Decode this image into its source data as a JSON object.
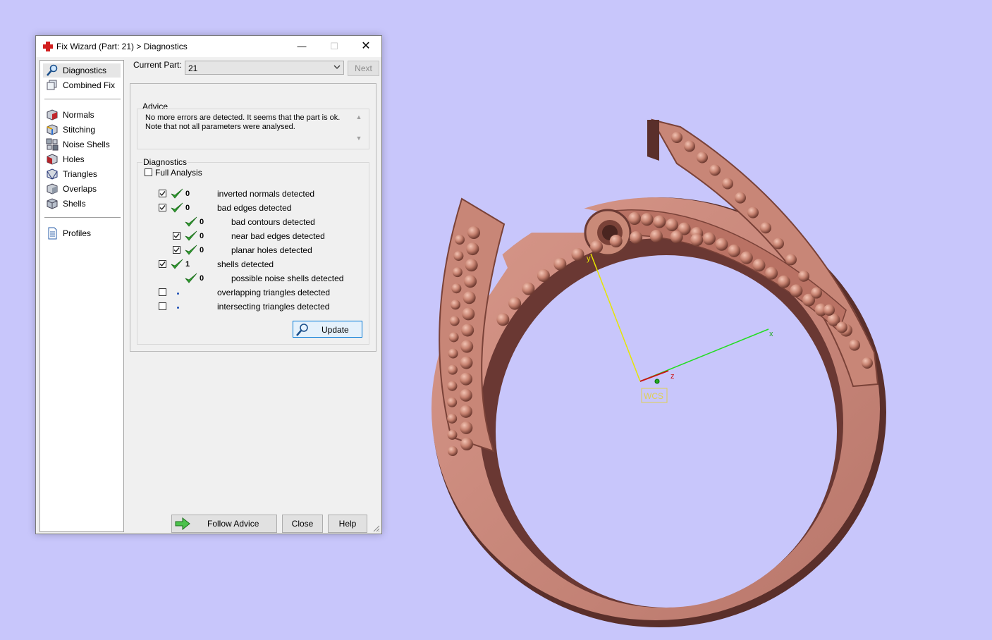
{
  "window": {
    "title": "Fix Wizard (Part: 21) > Diagnostics",
    "controls": {
      "minimize": "—",
      "maximize": "☐",
      "close": "✕"
    }
  },
  "sidebar": {
    "groups": [
      [
        {
          "label": "Diagnostics",
          "icon": "magnifier-icon",
          "selected": true
        },
        {
          "label": "Combined Fix",
          "icon": "cube-stack-icon"
        }
      ],
      [
        {
          "label": "Normals",
          "icon": "normals-cube-icon"
        },
        {
          "label": "Stitching",
          "icon": "stitching-cube-icon"
        },
        {
          "label": "Noise Shells",
          "icon": "noise-shells-icon"
        },
        {
          "label": "Holes",
          "icon": "holes-cube-icon"
        },
        {
          "label": "Triangles",
          "icon": "triangles-cube-icon"
        },
        {
          "label": "Overlaps",
          "icon": "overlaps-cube-icon"
        },
        {
          "label": "Shells",
          "icon": "shells-cube-icon"
        }
      ],
      [
        {
          "label": "Profiles",
          "icon": "document-icon"
        }
      ]
    ]
  },
  "header": {
    "current_part_label": "Current Part:",
    "current_part_value": "21",
    "next_label": "Next"
  },
  "advice": {
    "title": "Advice",
    "text": "No more errors are detected. It seems that the part is ok. Note that not all parameters were analysed."
  },
  "diagnostics": {
    "title": "Diagnostics",
    "full_analysis_label": "Full Analysis",
    "full_analysis_checked": false,
    "rows": [
      {
        "checked": true,
        "has_checkbox": true,
        "status": "ok",
        "count": "0",
        "label": "inverted normals detected",
        "indent": 0
      },
      {
        "checked": true,
        "has_checkbox": true,
        "status": "ok",
        "count": "0",
        "label": "bad edges detected",
        "indent": 0
      },
      {
        "checked": false,
        "has_checkbox": false,
        "status": "ok",
        "count": "0",
        "label": "bad contours detected",
        "indent": 1
      },
      {
        "checked": true,
        "has_checkbox": true,
        "status": "ok",
        "count": "0",
        "label": "near bad edges detected",
        "indent": 1
      },
      {
        "checked": true,
        "has_checkbox": true,
        "status": "ok",
        "count": "0",
        "label": "planar holes detected",
        "indent": 1
      },
      {
        "checked": true,
        "has_checkbox": true,
        "status": "ok",
        "count": "1",
        "label": "shells detected",
        "indent": 0
      },
      {
        "checked": false,
        "has_checkbox": false,
        "status": "ok",
        "count": "0",
        "label": "possible noise shells detected",
        "indent": 1
      },
      {
        "checked": false,
        "has_checkbox": true,
        "status": "pending",
        "count": "",
        "label": "overlapping triangles detected",
        "indent": 0
      },
      {
        "checked": false,
        "has_checkbox": true,
        "status": "pending",
        "count": "",
        "label": "intersecting triangles detected",
        "indent": 0
      }
    ],
    "update_label": "Update"
  },
  "footer": {
    "follow_advice_label": "Follow Advice",
    "close_label": "Close",
    "help_label": "Help"
  },
  "viewport": {
    "background": "#c8c6fb",
    "model_color": "#c98a78",
    "axis_labels": {
      "x": "x",
      "y": "y",
      "z": "z",
      "wcs": "WCS"
    }
  }
}
